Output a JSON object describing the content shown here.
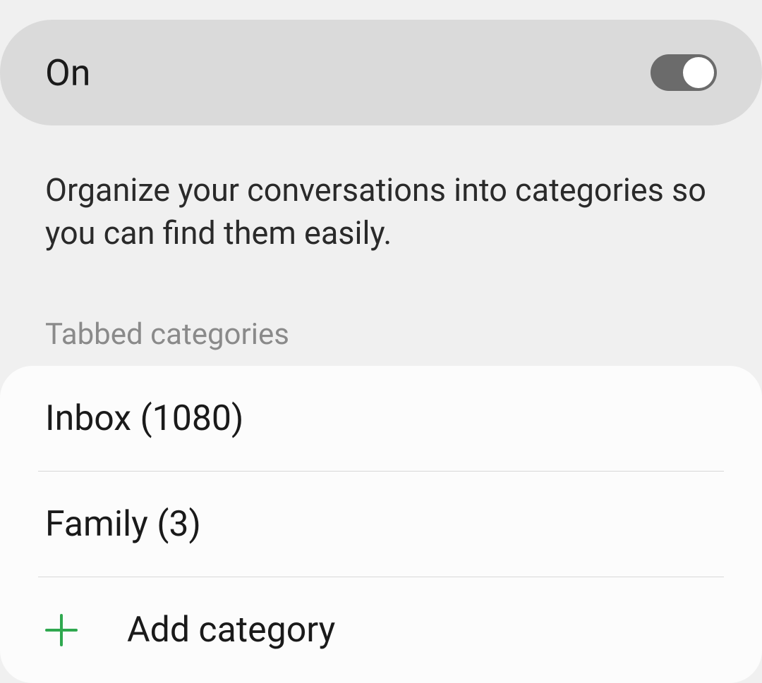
{
  "toggle": {
    "label": "On",
    "state": "on"
  },
  "description": "Organize your conversations into categories so you can find them easily.",
  "section_header": "Tabbed categories",
  "categories": [
    {
      "label": "Inbox (1080)"
    },
    {
      "label": "Family (3)"
    }
  ],
  "add_category": {
    "label": "Add category"
  },
  "colors": {
    "accent_green": "#2fa84f"
  }
}
